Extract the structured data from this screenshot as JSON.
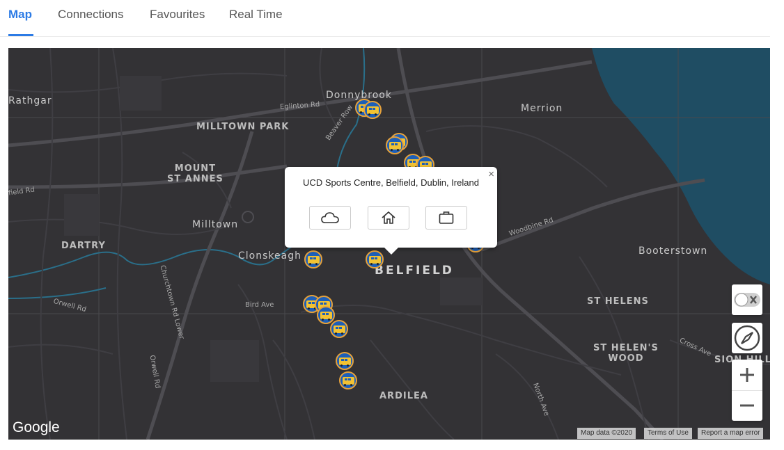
{
  "tabs": [
    {
      "label": "Map",
      "active": true
    },
    {
      "label": "Connections",
      "active": false
    },
    {
      "label": "Favourites",
      "active": false
    },
    {
      "label": "Real Time",
      "active": false
    }
  ],
  "map": {
    "labels": {
      "donnybrook": "Donnybrook",
      "merrion": "Merrion",
      "rathgar": "Rathgar",
      "milltown_park": "MILLTOWN PARK",
      "mount_st_annes": "MOUNT\nST ANNES",
      "milltown": "Milltown",
      "dartry": "DARTRY",
      "clonskeagh": "Clonskeagh",
      "belfield": "BELFIELD",
      "booterstown": "Booterstown",
      "st_helens": "ST HELENS",
      "st_helens_wood": "ST HELEN'S\nWOOD",
      "sion_hill": "SION HILL",
      "ardilea": "ARDILEA",
      "eglinton_rd": "Eglinton Rd",
      "beaver_row": "Beaver Row",
      "field_rd": "field Rd",
      "woodbine_rd": "Woodbine Rd",
      "bird_ave": "Bird Ave",
      "orwell_rd": "Orwell Rd",
      "orwell_rd_2": "Orwell Rd",
      "churchtown_rd_lower": "Churchtown Rd Lower",
      "cross_ave": "Cross Ave",
      "north_ave": "North Ave"
    },
    "popup": {
      "title": "UCD Sports Centre, Belfield, Dublin, Ireland",
      "close": "×",
      "buttons": [
        "cloud-icon",
        "home-icon",
        "briefcase-icon"
      ]
    },
    "google_logo": "Google",
    "attribution": {
      "map_data": "Map data ©2020",
      "terms": "Terms of Use",
      "report": "Report a map error"
    },
    "colors": {
      "accent": "#2c7be5",
      "map_bg": "#333235",
      "water": "#1f4d63",
      "stop_fill": "#1d5fb8",
      "stop_ring": "#e6a23c"
    }
  }
}
